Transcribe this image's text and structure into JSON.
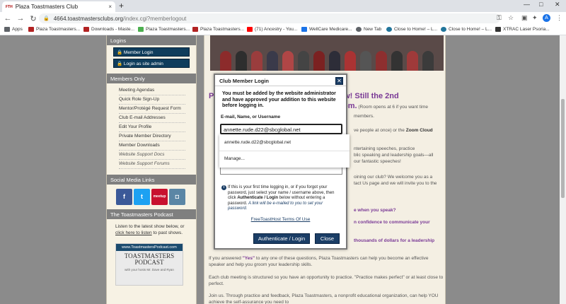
{
  "browser": {
    "tab_title": "Plaza Toastmasters Club",
    "tab_favicon": "FTH",
    "new_tab_glyph": "+",
    "close_tab_glyph": "×",
    "url_domain": "4664.toastmastersclubs.org",
    "url_path": "/index.cgi?memberlogout",
    "window_controls": [
      "—",
      "□",
      "✕"
    ],
    "bookmarks": [
      {
        "label": "Apps",
        "color": "#5f6368"
      },
      {
        "label": "Plaza Toastmasters...",
        "color": "#b22222"
      },
      {
        "label": "Downloads - Maste...",
        "color": "#b22222"
      },
      {
        "label": "Plaza Toastmasters...",
        "color": "#4caf50"
      },
      {
        "label": "Plaza Toastmasters...",
        "color": "#b22222"
      },
      {
        "label": "(71) Ancestry - You...",
        "color": "#ff0000"
      },
      {
        "label": "WellCare Medicare...",
        "color": "#1a73e8"
      },
      {
        "label": "New Tab",
        "color": "#5f6368"
      },
      {
        "label": "Close to Home! – L...",
        "color": "#21759b"
      },
      {
        "label": "Close to Home! – L...",
        "color": "#21759b"
      },
      {
        "label": "XTRAC Laser Psoria...",
        "color": "#333333"
      }
    ],
    "avatar_letter": "A"
  },
  "sidebar": {
    "login_heading": "Logins",
    "member_login": "Member Login",
    "site_admin_login": "Login as site admin",
    "members_heading": "Members Only",
    "member_links": [
      "Meeting Agendas",
      "Quick Role Sign-Up",
      "Mentor/Protégé Request Form",
      "Club E-mail Addresses",
      "Edit Your Profile",
      "Private Member Directory",
      "Member Downloads",
      "Website Support Docs",
      "Website Support Forums"
    ],
    "social_heading": "Social Media Links",
    "social_icons": [
      "f",
      "t",
      "meetup",
      "◘"
    ],
    "podcast_heading": "The Toastmasters Podcast",
    "podcast_text_1": "Listen to the latest show below, or",
    "podcast_link": "click here to listen",
    "podcast_text_2": "to past shows.",
    "podcast_url": "www.ToastmastersPodcast.com",
    "podcast_title": "TOASTMASTERS PODCAST",
    "podcast_sub": "with your hosts Mr. Dave and Ryan"
  },
  "main": {
    "headline_a": "Plaza Toastmasters are online for now! Still the 2nd",
    "headline_b": "pm.",
    "paragraph_1_tail": "(Room opens at 6 if you want time",
    "paragraph_1_b": "members.",
    "paragraph_2_tail": "ve people at once) or the",
    "zoom_label": "Zoom Cloud",
    "paragraph_3_a": "ntertaining speeches, practice",
    "paragraph_3_b": "blic speaking and leadership goals—all",
    "paragraph_3_c": "our fantastic speeches!",
    "paragraph_4_a": "oining our club? We welcome you as a",
    "paragraph_4_b": "tact Us page and we will invite you to the",
    "question_1": "e when you speak?",
    "question_2": "n confidence to communicate your",
    "question_3": "thousands of dollars for a leadership",
    "answer_yes_pre": "If you answered",
    "answer_yes_word": "\"Yes\"",
    "answer_yes_post": "to any one of these questions, Plaza Toastmasters can help you become an effective speaker and help you groom your leadership skills.",
    "paragraph_5": "Each club meeting is structured so you have an opportunity to practice. \"Practice makes perfect\" or at least close to perfect.",
    "paragraph_6": "Join us. Through practice and feedback, Plaza Toastmasters, a nonprofit educational organization, can help YOU achieve the self-assurance you need to"
  },
  "modal": {
    "title": "Club Member Login",
    "close_glyph": "✕",
    "intro": "You must be added by the website administrator and have approved your addition to this website before logging in.",
    "field_label": "E-mail, Name, or Username",
    "field_value": "annette.rude.d22@sbcglobal.net",
    "info_icon": "i",
    "info_text_1": "If this is your first time logging in, or if you forgot your password, just select your name / username above, then click",
    "info_bold": "Authenticate / Login",
    "info_text_2": "below without entering a password.",
    "info_italic": "A link will be e-mailed to you to set your password.",
    "terms_link": "FreeToastHost Terms Of Use",
    "authenticate_button": "Authenticate / Login",
    "close_button": "Close"
  },
  "autocomplete": {
    "suggestion": "annette.rude.d22@sbcglobal.net",
    "manage": "Manage..."
  }
}
